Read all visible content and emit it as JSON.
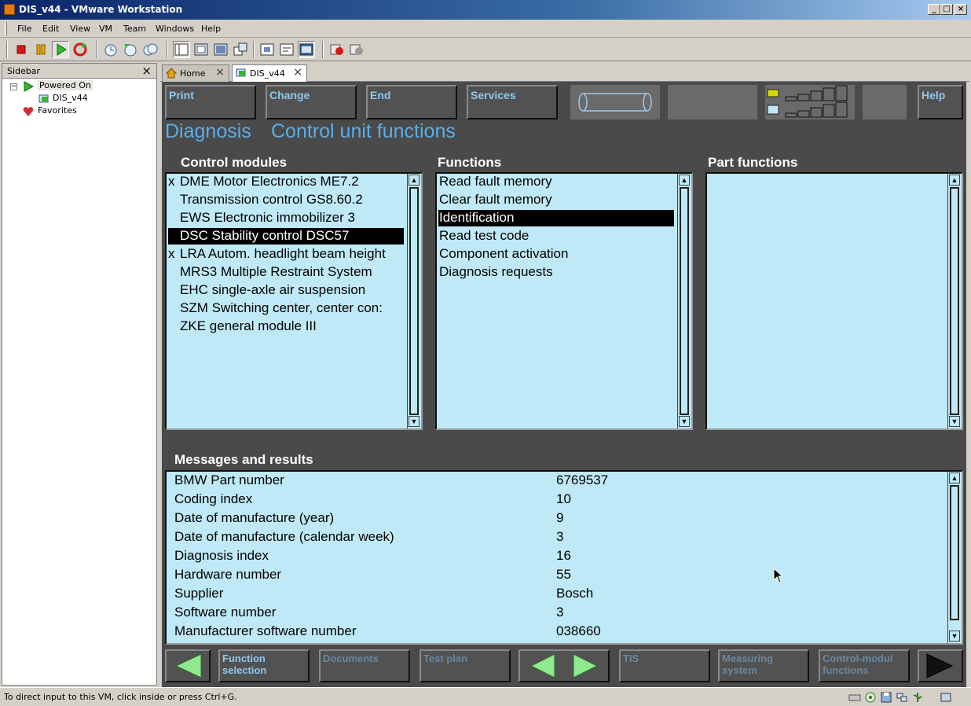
{
  "window": {
    "title": "DIS_v44 - VMware Workstation",
    "accent": "#0a246a"
  },
  "menu": [
    "File",
    "Edit",
    "View",
    "VM",
    "Team",
    "Windows",
    "Help"
  ],
  "toolbar": {
    "icons": [
      "power-off-icon",
      "suspend-icon",
      "power-on-icon",
      "reset-icon",
      "snapshot-icon",
      "revert-snapshot-icon",
      "snapshot-manager-icon",
      "sidebar-toggle-icon",
      "quick-switch-icon",
      "fullscreen-icon",
      "unity-icon",
      "summary-icon",
      "console-icon",
      "appliance-view-icon",
      "record-icon",
      "replay-icon"
    ]
  },
  "sidebar": {
    "title": "Sidebar",
    "powered_on": "Powered On",
    "vm_name": "DIS_v44",
    "favorites": "Favorites"
  },
  "tabs": [
    {
      "label": "Home"
    },
    {
      "label": "DIS_v44"
    }
  ],
  "dis": {
    "top_buttons": {
      "print": "Print",
      "change": "Change",
      "end": "End",
      "services": "Services",
      "help": "Help"
    },
    "header": {
      "section": "Diagnosis",
      "page": "Control unit functions"
    },
    "control_modules": {
      "title": "Control modules",
      "items": [
        {
          "mark": "x",
          "text": "DME Motor Electronics ME7.2"
        },
        {
          "mark": "",
          "text": "Transmission control GS8.60.2"
        },
        {
          "mark": "",
          "text": "EWS Electronic immobilizer 3"
        },
        {
          "mark": "",
          "text": "DSC Stability control DSC57",
          "selected": true
        },
        {
          "mark": "x",
          "text": "LRA Autom. headlight beam height"
        },
        {
          "mark": "",
          "text": "MRS3 Multiple Restraint System"
        },
        {
          "mark": "",
          "text": "EHC single-axle air suspension"
        },
        {
          "mark": "",
          "text": "SZM Switching center, center con:"
        },
        {
          "mark": "",
          "text": "ZKE general module III"
        }
      ]
    },
    "functions": {
      "title": "Functions",
      "items": [
        {
          "text": "Read fault memory"
        },
        {
          "text": "Clear fault memory"
        },
        {
          "text": "Identification",
          "selected": true
        },
        {
          "text": "Read test code"
        },
        {
          "text": "Component activation"
        },
        {
          "text": "Diagnosis requests"
        }
      ]
    },
    "part_functions": {
      "title": "Part functions"
    },
    "messages": {
      "title": "Messages and results",
      "rows": [
        {
          "key": "BMW Part number",
          "value": "6769537"
        },
        {
          "key": "Coding index",
          "value": "10"
        },
        {
          "key": "Date of manufacture (year)",
          "value": "9"
        },
        {
          "key": "Date of manufacture (calendar week)",
          "value": "3"
        },
        {
          "key": "Diagnosis index",
          "value": "16"
        },
        {
          "key": "Hardware number",
          "value": "55"
        },
        {
          "key": "Supplier",
          "value": "Bosch"
        },
        {
          "key": "Software number",
          "value": "3"
        },
        {
          "key": "Manufacturer software number",
          "value": "038660"
        }
      ]
    },
    "bottom_buttons": {
      "function_selection_1": "Function",
      "function_selection_2": "selection",
      "documents": "Documents",
      "test_plan": "Test plan",
      "tis": "TIS",
      "measuring_1": "Measuring",
      "measuring_2": "system",
      "control_1": "Control-modul",
      "control_2": "functions"
    }
  },
  "statusbar": {
    "message": "To direct input to this VM, click inside or press Ctrl+G."
  }
}
